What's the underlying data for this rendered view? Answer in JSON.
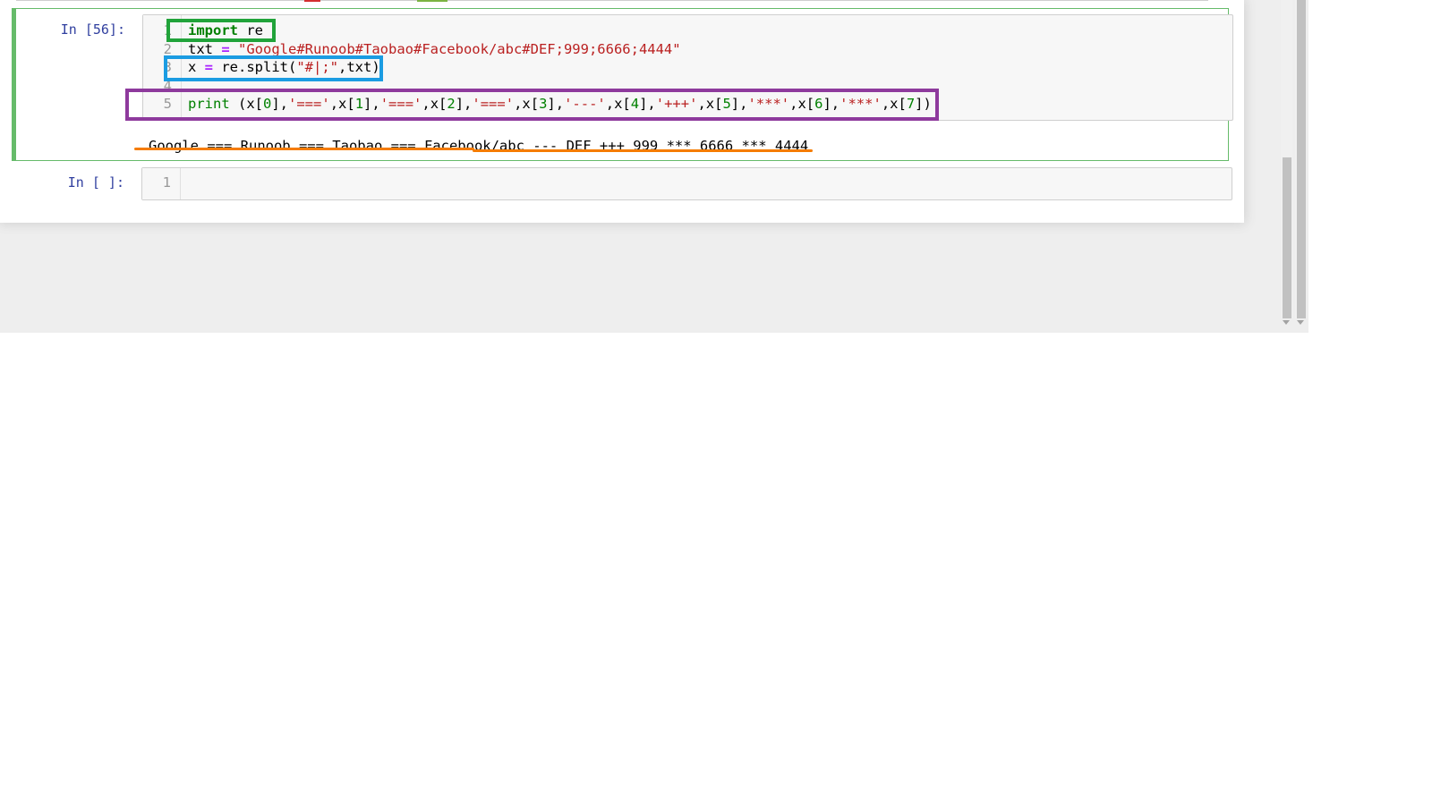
{
  "cells": [
    {
      "prompt": "In [56]:",
      "lines": [
        {
          "num": "1",
          "tokens": [
            {
              "t": "import",
              "c": "kw"
            },
            {
              "t": " re",
              "c": "var"
            }
          ]
        },
        {
          "num": "2",
          "tokens": [
            {
              "t": "txt ",
              "c": "var"
            },
            {
              "t": "=",
              "c": "op"
            },
            {
              "t": " ",
              "c": "var"
            },
            {
              "t": "\"Google#Runoob#Taobao#Facebook/abc#DEF;999;6666;4444\"",
              "c": "str"
            }
          ]
        },
        {
          "num": "3",
          "tokens": [
            {
              "t": "x ",
              "c": "var"
            },
            {
              "t": "=",
              "c": "op"
            },
            {
              "t": " re.split(",
              "c": "var"
            },
            {
              "t": "\"#|;\"",
              "c": "str"
            },
            {
              "t": ",txt)",
              "c": "var"
            }
          ]
        },
        {
          "num": "4",
          "tokens": []
        },
        {
          "num": "5",
          "tokens": [
            {
              "t": "print",
              "c": "fn"
            },
            {
              "t": " (x[",
              "c": "var"
            },
            {
              "t": "0",
              "c": "num"
            },
            {
              "t": "],",
              "c": "var"
            },
            {
              "t": "'==='",
              "c": "str"
            },
            {
              "t": ",x[",
              "c": "var"
            },
            {
              "t": "1",
              "c": "num"
            },
            {
              "t": "],",
              "c": "var"
            },
            {
              "t": "'==='",
              "c": "str"
            },
            {
              "t": ",x[",
              "c": "var"
            },
            {
              "t": "2",
              "c": "num"
            },
            {
              "t": "],",
              "c": "var"
            },
            {
              "t": "'==='",
              "c": "str"
            },
            {
              "t": ",x[",
              "c": "var"
            },
            {
              "t": "3",
              "c": "num"
            },
            {
              "t": "],",
              "c": "var"
            },
            {
              "t": "'---'",
              "c": "str"
            },
            {
              "t": ",x[",
              "c": "var"
            },
            {
              "t": "4",
              "c": "num"
            },
            {
              "t": "],",
              "c": "var"
            },
            {
              "t": "'+++'",
              "c": "str"
            },
            {
              "t": ",x[",
              "c": "var"
            },
            {
              "t": "5",
              "c": "num"
            },
            {
              "t": "],",
              "c": "var"
            },
            {
              "t": "'***'",
              "c": "str"
            },
            {
              "t": ",x[",
              "c": "var"
            },
            {
              "t": "6",
              "c": "num"
            },
            {
              "t": "],",
              "c": "var"
            },
            {
              "t": "'***'",
              "c": "str"
            },
            {
              "t": ",x[",
              "c": "var"
            },
            {
              "t": "7",
              "c": "num"
            },
            {
              "t": "])",
              "c": "var"
            }
          ]
        }
      ],
      "output": "Google === Runoob === Taobao === Facebook/abc --- DEF +++ 999 *** 6666 *** 4444"
    },
    {
      "prompt": "In [ ]:",
      "lines": [
        {
          "num": "1",
          "tokens": []
        }
      ]
    }
  ],
  "colors": {
    "annotation_import": "#21a33a",
    "annotation_split": "#1b9ce2",
    "annotation_print": "#8e3a9d",
    "annotation_output": "#f57c00",
    "active_cell_border": "#66bb6a"
  }
}
